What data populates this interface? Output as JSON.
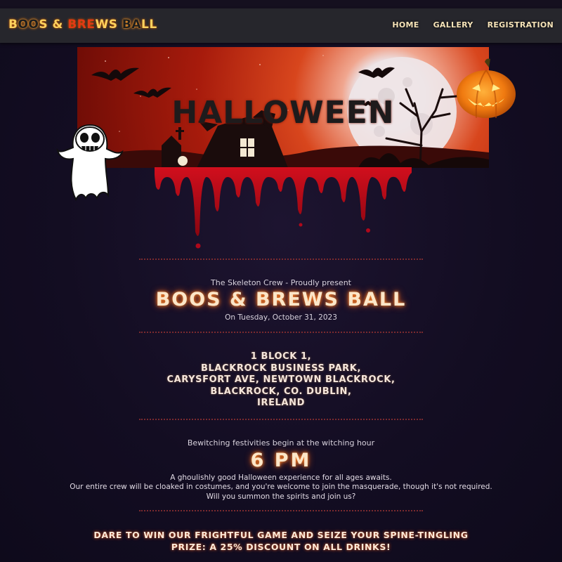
{
  "nav": {
    "brand_parts": [
      {
        "text": "B",
        "cls": "c2"
      },
      {
        "text": "OO",
        "cls": "c1"
      },
      {
        "text": "S & ",
        "cls": "c2"
      },
      {
        "text": "BRE",
        "cls": "c3"
      },
      {
        "text": "WS ",
        "cls": "c2"
      },
      {
        "text": "BA",
        "cls": "c1"
      },
      {
        "text": "LL",
        "cls": "c2"
      }
    ],
    "links": [
      "HOME",
      "GALLERY",
      "REGISTRATION"
    ]
  },
  "banner": {
    "title": "HALLOWEEN"
  },
  "event": {
    "presenter": "The Skeleton Crew - Proudly present",
    "title": "BOOS & BREWS BALL",
    "date": "On Tuesday, October 31, 2023",
    "address": [
      "1 BLOCK 1,",
      "BLACKROCK BUSINESS PARK,",
      "CARYSFORT AVE, NEWTOWN BLACKROCK,",
      "BLACKROCK, CO. DUBLIN,",
      "IRELAND"
    ],
    "begin_text": "Bewitching festivities begin at the witching hour",
    "time": "6 PM",
    "description": [
      "A ghoulishly good Halloween experience for all ages awaits.",
      "Our entire crew will be cloaked in costumes, and you're welcome to join the masquerade, though it's not required.",
      "Will you summon the spirits and join us?"
    ],
    "dare": [
      "DARE TO WIN OUR FRIGHTFUL GAME AND SEIZE YOUR SPINE-TINGLING",
      "PRIZE: A 25% DISCOUNT ON ALL DRINKS!"
    ]
  },
  "colors": {
    "background": "#130d22",
    "navbar": "#26262c",
    "accent_orange": "#ff8a2a",
    "nav_text": "#f6e3b8",
    "blood": "#c0081a",
    "divider": "#7a2a2f"
  },
  "icons": [
    "ghost-icon",
    "pumpkin-icon",
    "bat-icon",
    "moon-icon",
    "haunted-house-icon",
    "blood-drip-icon"
  ]
}
